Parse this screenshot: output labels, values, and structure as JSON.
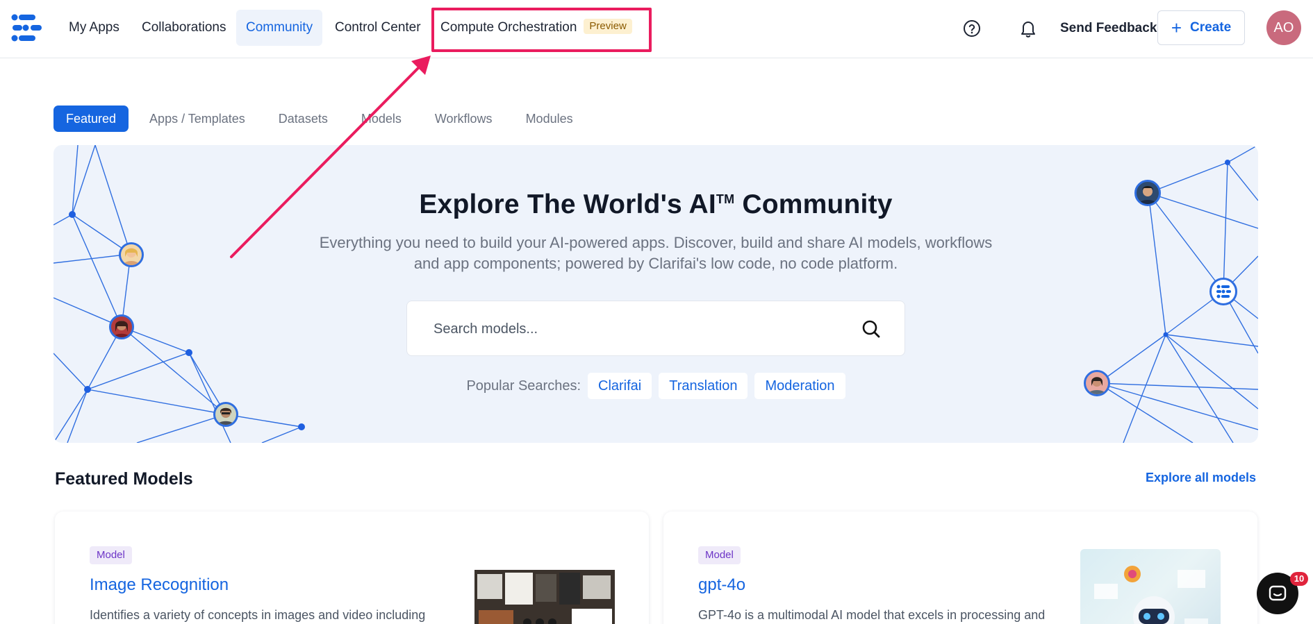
{
  "nav": {
    "items": [
      {
        "label": "My Apps",
        "active": false
      },
      {
        "label": "Collaborations",
        "active": false
      },
      {
        "label": "Community",
        "active": true
      },
      {
        "label": "Control Center",
        "active": false
      }
    ],
    "compute": {
      "label": "Compute Orchestration",
      "badge": "Preview"
    },
    "help_icon": "help-circle-icon",
    "bell_icon": "bell-icon",
    "feedback_label": "Send Feedback",
    "create_label": "Create",
    "avatar_initials": "AO",
    "avatar_color": "#c96a7d"
  },
  "tabs": [
    {
      "label": "Featured",
      "active": true
    },
    {
      "label": "Apps / Templates",
      "active": false
    },
    {
      "label": "Datasets",
      "active": false
    },
    {
      "label": "Models",
      "active": false
    },
    {
      "label": "Workflows",
      "active": false
    },
    {
      "label": "Modules",
      "active": false
    }
  ],
  "hero": {
    "title": "Explore The World's AI",
    "title_tm": "TM",
    "title_suffix": " Community",
    "subtitle": "Everything you need to build your AI-powered apps. Discover, build and share AI models, workflows and app components; powered by Clarifai's low code, no code platform.",
    "search_placeholder": "Search models...",
    "popular_label": "Popular Searches:",
    "popular": [
      "Clarifai",
      "Translation",
      "Moderation"
    ]
  },
  "featured": {
    "title": "Featured Models",
    "explore_label": "Explore all models",
    "cards": [
      {
        "badge": "Model",
        "title": "Image Recognition",
        "desc": "Identifies a variety of concepts in images and video including"
      },
      {
        "badge": "Model",
        "title": "gpt-4o",
        "desc": "GPT-4o is a multimodal AI model that excels in processing and"
      }
    ]
  },
  "chat": {
    "count": "10"
  },
  "colors": {
    "accent": "#1565e0",
    "highlight": "#ea1c5e",
    "hero_bg": "#eef3fb"
  }
}
